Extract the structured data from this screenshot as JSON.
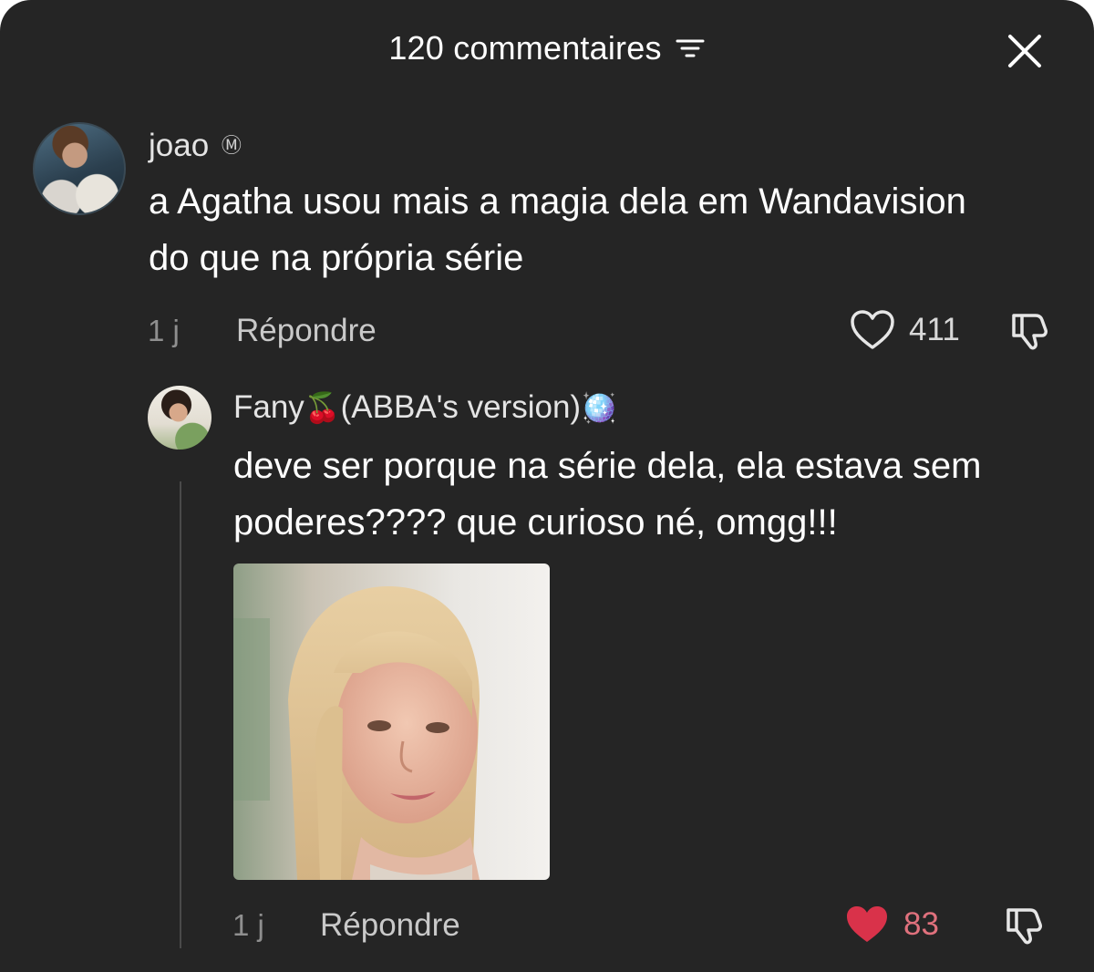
{
  "header": {
    "title": "120 commentaires",
    "filter_icon": "filter-lines-icon",
    "close_icon": "close-icon"
  },
  "colors": {
    "background": "#252525",
    "text": "#ffffff",
    "muted": "#8f8f8f",
    "liked_heart": "#d9324a",
    "liked_count": "#e0717d"
  },
  "comments": [
    {
      "username": "joao",
      "badge": "Ⓜ",
      "text": "a Agatha usou mais a magia dela em Wandavision do que na própria série",
      "age": "1 j",
      "reply_label": "Répondre",
      "likes": "411",
      "liked": false
    }
  ],
  "replies": [
    {
      "username": "Fany",
      "name_emoji_1": "🍒",
      "name_middle": "(ABBA's version)",
      "name_emoji_2": "🪩",
      "text": "deve ser porque na série dela, ela estava sem poderes???? que curioso né, omgg!!!",
      "has_image": true,
      "age": "1 j",
      "reply_label": "Répondre",
      "likes": "83",
      "liked": true
    }
  ]
}
